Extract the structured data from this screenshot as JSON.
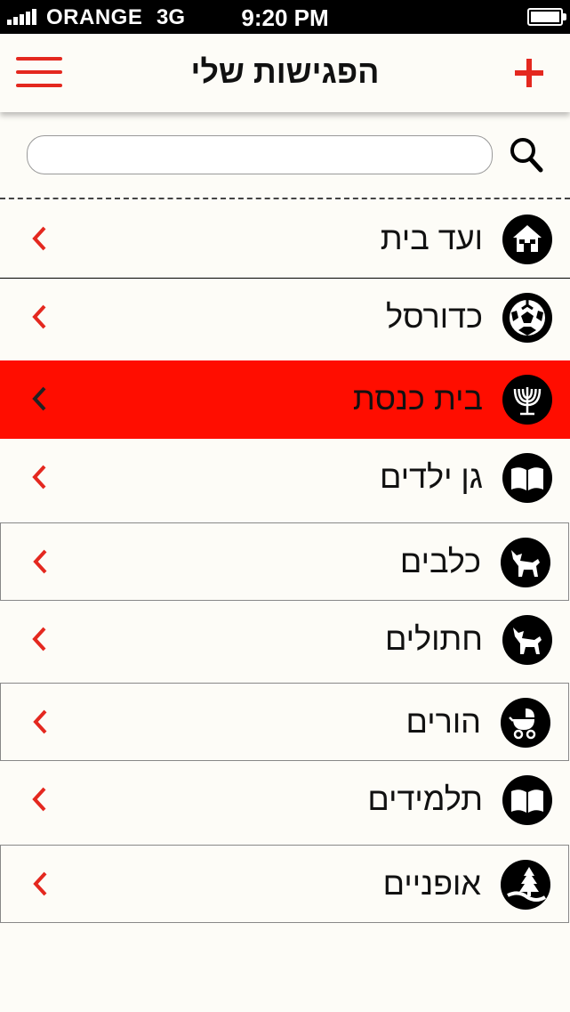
{
  "status_bar": {
    "carrier": "ORANGE",
    "network": "3G",
    "time": "9:20 PM",
    "battery_level": 1.0
  },
  "nav": {
    "title": "הפגישות שלי",
    "menu_icon": "hamburger-menu-icon",
    "add_icon": "plus-icon"
  },
  "search": {
    "placeholder": "",
    "value": "",
    "icon": "search-icon"
  },
  "colors": {
    "accent": "#e4281f",
    "selected_row": "#ff0d00",
    "background": "#fdfcf7",
    "icon_circle": "#000000"
  },
  "groups": [
    {
      "label": "ועד בית",
      "icon": "house-icon"
    },
    {
      "label": "כדורסל",
      "icon": "soccer-ball-icon"
    },
    {
      "label": "בית כנסת",
      "icon": "menorah-icon",
      "selected": true
    },
    {
      "label": "גן ילדים",
      "icon": "open-book-icon"
    },
    {
      "label": "כלבים",
      "icon": "dog-icon"
    },
    {
      "label": "חתולים",
      "icon": "cat-icon"
    },
    {
      "label": "הורים",
      "icon": "baby-stroller-icon"
    },
    {
      "label": "תלמידים",
      "icon": "open-book-icon"
    },
    {
      "label": "אופניים",
      "icon": "tree-path-icon"
    }
  ]
}
